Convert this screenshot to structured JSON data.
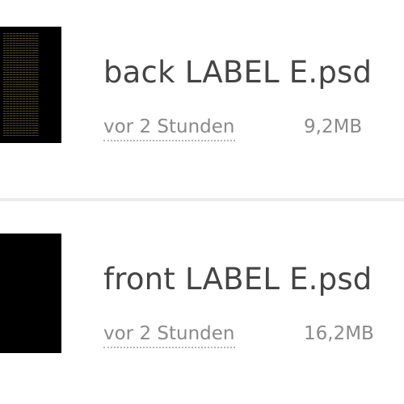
{
  "files": [
    {
      "name": "back LABEL E.psd",
      "modified": "vor 2 Stunden",
      "size": "9,2MB",
      "thumbnail": "dark-text-label-thumbnail"
    },
    {
      "name": "front LABEL E.psd",
      "modified": "vor 2 Stunden",
      "size": "16,2MB",
      "thumbnail": "black-thumbnail"
    }
  ],
  "colors": {
    "text_primary": "#444444",
    "text_secondary": "#8a8a8a",
    "divider": "#ececec",
    "thumbnail_bg": "#000000"
  }
}
